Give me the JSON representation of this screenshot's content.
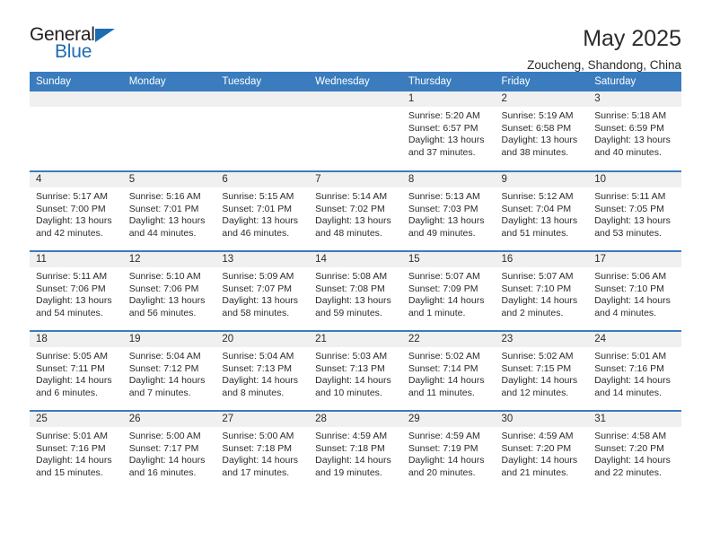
{
  "brand": {
    "name_top": "General",
    "name_bottom": "Blue",
    "triangle_color": "#1c6cb3"
  },
  "header": {
    "month_title": "May 2025",
    "location": "Zoucheng, Shandong, China"
  },
  "colors": {
    "header_blue": "#3a7cbe",
    "daynum_band": "#f0f0f0",
    "text": "#2b2b2b"
  },
  "weekdays": [
    "Sunday",
    "Monday",
    "Tuesday",
    "Wednesday",
    "Thursday",
    "Friday",
    "Saturday"
  ],
  "weeks": [
    [
      {
        "day": "",
        "empty": true
      },
      {
        "day": "",
        "empty": true
      },
      {
        "day": "",
        "empty": true
      },
      {
        "day": "",
        "empty": true
      },
      {
        "day": "1",
        "sunrise": "Sunrise: 5:20 AM",
        "sunset": "Sunset: 6:57 PM",
        "daylight1": "Daylight: 13 hours",
        "daylight2": "and 37 minutes."
      },
      {
        "day": "2",
        "sunrise": "Sunrise: 5:19 AM",
        "sunset": "Sunset: 6:58 PM",
        "daylight1": "Daylight: 13 hours",
        "daylight2": "and 38 minutes."
      },
      {
        "day": "3",
        "sunrise": "Sunrise: 5:18 AM",
        "sunset": "Sunset: 6:59 PM",
        "daylight1": "Daylight: 13 hours",
        "daylight2": "and 40 minutes."
      }
    ],
    [
      {
        "day": "4",
        "sunrise": "Sunrise: 5:17 AM",
        "sunset": "Sunset: 7:00 PM",
        "daylight1": "Daylight: 13 hours",
        "daylight2": "and 42 minutes."
      },
      {
        "day": "5",
        "sunrise": "Sunrise: 5:16 AM",
        "sunset": "Sunset: 7:01 PM",
        "daylight1": "Daylight: 13 hours",
        "daylight2": "and 44 minutes."
      },
      {
        "day": "6",
        "sunrise": "Sunrise: 5:15 AM",
        "sunset": "Sunset: 7:01 PM",
        "daylight1": "Daylight: 13 hours",
        "daylight2": "and 46 minutes."
      },
      {
        "day": "7",
        "sunrise": "Sunrise: 5:14 AM",
        "sunset": "Sunset: 7:02 PM",
        "daylight1": "Daylight: 13 hours",
        "daylight2": "and 48 minutes."
      },
      {
        "day": "8",
        "sunrise": "Sunrise: 5:13 AM",
        "sunset": "Sunset: 7:03 PM",
        "daylight1": "Daylight: 13 hours",
        "daylight2": "and 49 minutes."
      },
      {
        "day": "9",
        "sunrise": "Sunrise: 5:12 AM",
        "sunset": "Sunset: 7:04 PM",
        "daylight1": "Daylight: 13 hours",
        "daylight2": "and 51 minutes."
      },
      {
        "day": "10",
        "sunrise": "Sunrise: 5:11 AM",
        "sunset": "Sunset: 7:05 PM",
        "daylight1": "Daylight: 13 hours",
        "daylight2": "and 53 minutes."
      }
    ],
    [
      {
        "day": "11",
        "sunrise": "Sunrise: 5:11 AM",
        "sunset": "Sunset: 7:06 PM",
        "daylight1": "Daylight: 13 hours",
        "daylight2": "and 54 minutes."
      },
      {
        "day": "12",
        "sunrise": "Sunrise: 5:10 AM",
        "sunset": "Sunset: 7:06 PM",
        "daylight1": "Daylight: 13 hours",
        "daylight2": "and 56 minutes."
      },
      {
        "day": "13",
        "sunrise": "Sunrise: 5:09 AM",
        "sunset": "Sunset: 7:07 PM",
        "daylight1": "Daylight: 13 hours",
        "daylight2": "and 58 minutes."
      },
      {
        "day": "14",
        "sunrise": "Sunrise: 5:08 AM",
        "sunset": "Sunset: 7:08 PM",
        "daylight1": "Daylight: 13 hours",
        "daylight2": "and 59 minutes."
      },
      {
        "day": "15",
        "sunrise": "Sunrise: 5:07 AM",
        "sunset": "Sunset: 7:09 PM",
        "daylight1": "Daylight: 14 hours",
        "daylight2": "and 1 minute."
      },
      {
        "day": "16",
        "sunrise": "Sunrise: 5:07 AM",
        "sunset": "Sunset: 7:10 PM",
        "daylight1": "Daylight: 14 hours",
        "daylight2": "and 2 minutes."
      },
      {
        "day": "17",
        "sunrise": "Sunrise: 5:06 AM",
        "sunset": "Sunset: 7:10 PM",
        "daylight1": "Daylight: 14 hours",
        "daylight2": "and 4 minutes."
      }
    ],
    [
      {
        "day": "18",
        "sunrise": "Sunrise: 5:05 AM",
        "sunset": "Sunset: 7:11 PM",
        "daylight1": "Daylight: 14 hours",
        "daylight2": "and 6 minutes."
      },
      {
        "day": "19",
        "sunrise": "Sunrise: 5:04 AM",
        "sunset": "Sunset: 7:12 PM",
        "daylight1": "Daylight: 14 hours",
        "daylight2": "and 7 minutes."
      },
      {
        "day": "20",
        "sunrise": "Sunrise: 5:04 AM",
        "sunset": "Sunset: 7:13 PM",
        "daylight1": "Daylight: 14 hours",
        "daylight2": "and 8 minutes."
      },
      {
        "day": "21",
        "sunrise": "Sunrise: 5:03 AM",
        "sunset": "Sunset: 7:13 PM",
        "daylight1": "Daylight: 14 hours",
        "daylight2": "and 10 minutes."
      },
      {
        "day": "22",
        "sunrise": "Sunrise: 5:02 AM",
        "sunset": "Sunset: 7:14 PM",
        "daylight1": "Daylight: 14 hours",
        "daylight2": "and 11 minutes."
      },
      {
        "day": "23",
        "sunrise": "Sunrise: 5:02 AM",
        "sunset": "Sunset: 7:15 PM",
        "daylight1": "Daylight: 14 hours",
        "daylight2": "and 12 minutes."
      },
      {
        "day": "24",
        "sunrise": "Sunrise: 5:01 AM",
        "sunset": "Sunset: 7:16 PM",
        "daylight1": "Daylight: 14 hours",
        "daylight2": "and 14 minutes."
      }
    ],
    [
      {
        "day": "25",
        "sunrise": "Sunrise: 5:01 AM",
        "sunset": "Sunset: 7:16 PM",
        "daylight1": "Daylight: 14 hours",
        "daylight2": "and 15 minutes."
      },
      {
        "day": "26",
        "sunrise": "Sunrise: 5:00 AM",
        "sunset": "Sunset: 7:17 PM",
        "daylight1": "Daylight: 14 hours",
        "daylight2": "and 16 minutes."
      },
      {
        "day": "27",
        "sunrise": "Sunrise: 5:00 AM",
        "sunset": "Sunset: 7:18 PM",
        "daylight1": "Daylight: 14 hours",
        "daylight2": "and 17 minutes."
      },
      {
        "day": "28",
        "sunrise": "Sunrise: 4:59 AM",
        "sunset": "Sunset: 7:18 PM",
        "daylight1": "Daylight: 14 hours",
        "daylight2": "and 19 minutes."
      },
      {
        "day": "29",
        "sunrise": "Sunrise: 4:59 AM",
        "sunset": "Sunset: 7:19 PM",
        "daylight1": "Daylight: 14 hours",
        "daylight2": "and 20 minutes."
      },
      {
        "day": "30",
        "sunrise": "Sunrise: 4:59 AM",
        "sunset": "Sunset: 7:20 PM",
        "daylight1": "Daylight: 14 hours",
        "daylight2": "and 21 minutes."
      },
      {
        "day": "31",
        "sunrise": "Sunrise: 4:58 AM",
        "sunset": "Sunset: 7:20 PM",
        "daylight1": "Daylight: 14 hours",
        "daylight2": "and 22 minutes."
      }
    ]
  ]
}
